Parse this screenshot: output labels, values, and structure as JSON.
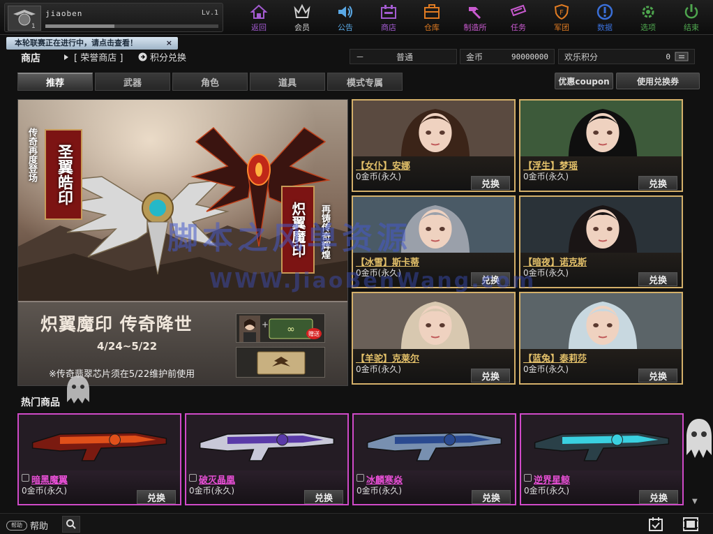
{
  "player": {
    "name": "jiaoben",
    "level": "Lv.1",
    "rank": "1",
    "xp_fraction": 0.4
  },
  "notice": {
    "text": "本轮联赛正在进行中，请点击查看！",
    "close": "×"
  },
  "nav": [
    {
      "label": "返回",
      "icon": "home-icon",
      "color": "#a35bd1"
    },
    {
      "label": "会员",
      "icon": "crown-icon",
      "color": "#cfcfcf"
    },
    {
      "label": "公告",
      "icon": "speaker-icon",
      "color": "#5aa9e6"
    },
    {
      "label": "商店",
      "icon": "shop-icon",
      "color": "#a35bd1"
    },
    {
      "label": "仓库",
      "icon": "box-icon",
      "color": "#e07b22"
    },
    {
      "label": "制造所",
      "icon": "hammer-icon",
      "color": "#c95ad0"
    },
    {
      "label": "任务",
      "icon": "ticket-icon",
      "color": "#c95ad0"
    },
    {
      "label": "军团",
      "icon": "shield-icon",
      "color": "#e07b22"
    },
    {
      "label": "数据",
      "icon": "info-icon",
      "color": "#3a6fd8"
    },
    {
      "label": "选项",
      "icon": "gear-icon",
      "color": "#4ea54e"
    },
    {
      "label": "结束",
      "icon": "power-icon",
      "color": "#4ea54e"
    }
  ],
  "header": {
    "title": "商店",
    "honor_shop": "[ 荣誉商店 ]",
    "points_exchange": "积分兑换",
    "mode_dash": "－",
    "mode_value": "普通",
    "gold_label": "金币",
    "gold_value": "90000000",
    "fun_label": "欢乐积分",
    "fun_value": "0"
  },
  "tabs": [
    "推荐",
    "武器",
    "角色",
    "道具",
    "模式专属"
  ],
  "right_buttons": {
    "coupon": "优惠coupon",
    "voucher": "使用兑换券"
  },
  "banner": {
    "vertical_title_1": "圣翼皓印",
    "vertical_sub_1": "传奇再度登场",
    "vertical_title_2": "炽翼魔印",
    "vertical_sub_2": "再铸传奇辉煌",
    "headline": "炽翼魔印 传奇降世",
    "date": "4/24~5/22",
    "note": "※传奇翡翠芯片须在5/22维护前使用",
    "hot_badge": "赠送"
  },
  "characters": [
    {
      "name": "【女仆】安娜",
      "price": "0金币(永久)",
      "button": "兑换",
      "bg": "#5a4a40",
      "hair": "#3b2418"
    },
    {
      "name": "【浮生】梦瑶",
      "price": "0金币(永久)",
      "button": "兑换",
      "bg": "#3d5a3a",
      "hair": "#0f0f0f"
    },
    {
      "name": "【冰雪】斯卡蒂",
      "price": "0金币(永久)",
      "button": "兑换",
      "bg": "#4a5a66",
      "hair": "#9aa0aa"
    },
    {
      "name": "【暗夜】诺克斯",
      "price": "0金币(永久)",
      "button": "兑换",
      "bg": "#2a3238",
      "hair": "#1a1515"
    },
    {
      "name": "【羊驼】克莱尔",
      "price": "0金币(永久)",
      "button": "兑换",
      "bg": "#6a6058",
      "hair": "#d8c8b0"
    },
    {
      "name": "【蓝兔】泰莉莎",
      "price": "0金币(永久)",
      "button": "兑换",
      "bg": "#5b6468",
      "hair": "#c8d8e0"
    }
  ],
  "hot_section": {
    "title": "热门商品"
  },
  "weapons": [
    {
      "name": "暗黑魔翼",
      "price": "0金币(永久)",
      "button": "兑换",
      "main": "#7a1a10",
      "accent": "#e0501a"
    },
    {
      "name": "破灭晶凰",
      "price": "0金币(永久)",
      "button": "兑换",
      "main": "#c8c8d8",
      "accent": "#5a3aa8"
    },
    {
      "name": "冰麟寒焱",
      "price": "0金币(永久)",
      "button": "兑换",
      "main": "#7890b0",
      "accent": "#2a4a90"
    },
    {
      "name": "逆界星鲸",
      "price": "0金币(永久)",
      "button": "兑换",
      "main": "#2a4048",
      "accent": "#3ad0e0"
    }
  ],
  "watermark": {
    "line1": "脚本之风单资源",
    "line2": "WWW.JiaoBenWang.com"
  },
  "bottom": {
    "help_badge": "帮助",
    "help": "帮助"
  }
}
